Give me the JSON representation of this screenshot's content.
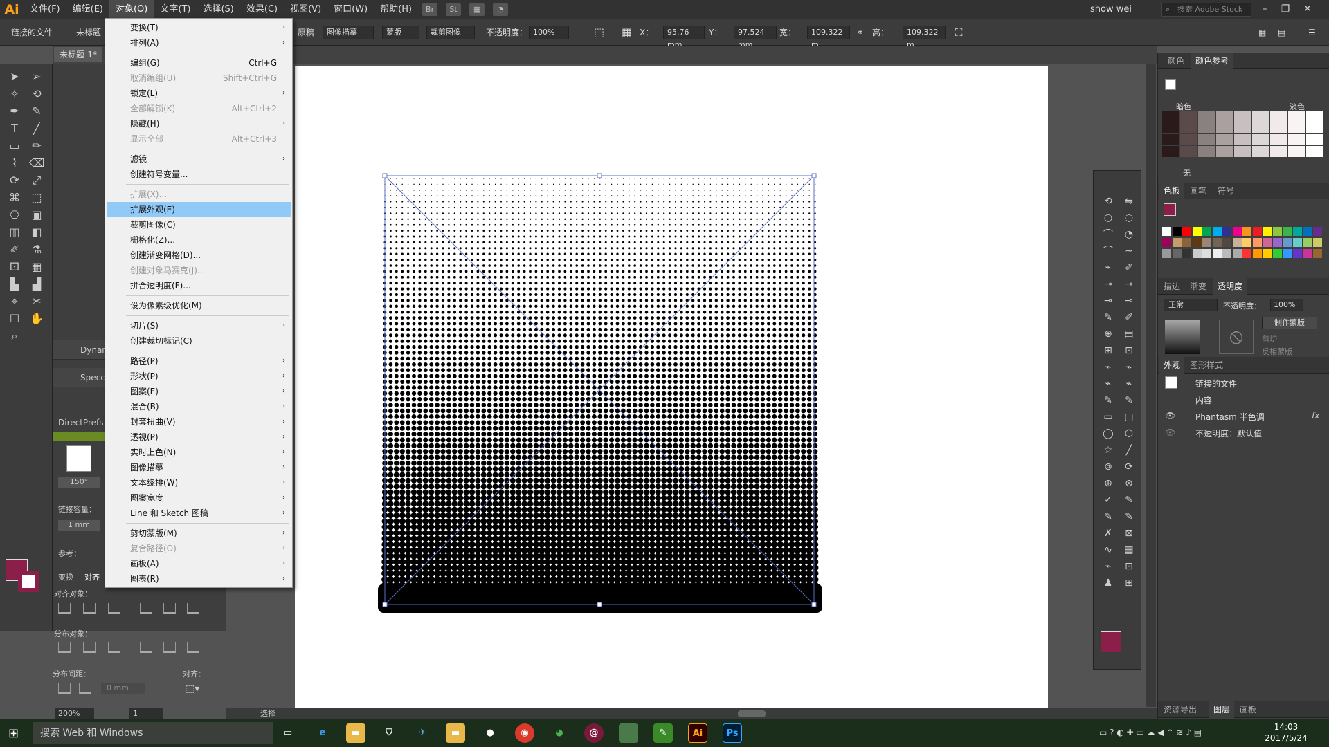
{
  "app": {
    "logo": "Ai",
    "menu": [
      "文件(F)",
      "编辑(E)",
      "对象(O)",
      "文字(T)",
      "选择(S)",
      "效果(C)",
      "视图(V)",
      "窗口(W)",
      "帮助(H)"
    ],
    "bridge": "Br",
    "stock": "St",
    "user": "show wei",
    "stock_search": "搜索 Adobe Stock"
  },
  "control": {
    "linked_file": "链接的文件",
    "unnamed": "未标题",
    "original": "原稿",
    "image_trace": "图像描摹",
    "mask": "蒙版",
    "crop_image": "裁剪图像",
    "opacity_label": "不透明度：",
    "opacity": "100%",
    "x_label": "X：",
    "x": "95.76 mm",
    "y_label": "Y：",
    "y": "97.524 mm",
    "w_label": "宽：",
    "w": "109.322 m",
    "h_label": "高：",
    "h": "109.322 m"
  },
  "doc": {
    "tab": "未标题-1*"
  },
  "left": {
    "dynamic": "Dynam",
    "spectr": "Specct",
    "directprefs": "DirectPrefs",
    "angle": "150°",
    "dashes_label": "链接容量：",
    "dashes": "1 mm",
    "ref_label": "参考：",
    "transform_tab": "变换",
    "align_tab": "对齐",
    "align_objects": "对齐对象：",
    "distribute_objects": "分布对象：",
    "distribute_spacing": "分布间距：",
    "align_to": "对齐：",
    "dist_value": "0 mm"
  },
  "dropdown": [
    {
      "label": "变换(T)",
      "arrow": "›",
      "dis": false
    },
    {
      "label": "排列(A)",
      "arrow": "›",
      "dis": false
    },
    {
      "sep": true
    },
    {
      "label": "编组(G)",
      "sc": "Ctrl+G",
      "dis": false
    },
    {
      "label": "取消编组(U)",
      "sc": "Shift+Ctrl+G",
      "dis": true
    },
    {
      "label": "锁定(L)",
      "arrow": "›",
      "dis": false
    },
    {
      "label": "全部解锁(K)",
      "sc": "Alt+Ctrl+2",
      "dis": true
    },
    {
      "label": "隐藏(H)",
      "arrow": "›",
      "dis": false
    },
    {
      "label": "显示全部",
      "sc": "Alt+Ctrl+3",
      "dis": true
    },
    {
      "sep": true
    },
    {
      "label": "滤镜",
      "arrow": "›",
      "dis": false
    },
    {
      "label": "创建符号变量...",
      "dis": false
    },
    {
      "sep": true
    },
    {
      "label": "扩展(X)...",
      "dis": true
    },
    {
      "label": "扩展外观(E)",
      "dis": false,
      "hl": true
    },
    {
      "label": "裁剪图像(C)",
      "dis": false
    },
    {
      "label": "栅格化(Z)...",
      "dis": false
    },
    {
      "label": "创建渐变网格(D)...",
      "dis": false
    },
    {
      "label": "创建对象马赛克(J)...",
      "dis": true
    },
    {
      "label": "拼合透明度(F)...",
      "dis": false
    },
    {
      "sep": true
    },
    {
      "label": "设为像素级优化(M)",
      "dis": false
    },
    {
      "sep": true
    },
    {
      "label": "切片(S)",
      "arrow": "›",
      "dis": false
    },
    {
      "label": "创建裁切标记(C)",
      "dis": false
    },
    {
      "sep": true
    },
    {
      "label": "路径(P)",
      "arrow": "›",
      "dis": false
    },
    {
      "label": "形状(P)",
      "arrow": "›",
      "dis": false
    },
    {
      "label": "图案(E)",
      "arrow": "›",
      "dis": false
    },
    {
      "label": "混合(B)",
      "arrow": "›",
      "dis": false
    },
    {
      "label": "封套扭曲(V)",
      "arrow": "›",
      "dis": false
    },
    {
      "label": "透视(P)",
      "arrow": "›",
      "dis": false
    },
    {
      "label": "实时上色(N)",
      "arrow": "›",
      "dis": false
    },
    {
      "label": "图像描摹",
      "arrow": "›",
      "dis": false
    },
    {
      "label": "文本绕排(W)",
      "arrow": "›",
      "dis": false
    },
    {
      "label": "图案宽度",
      "arrow": "›",
      "dis": false
    },
    {
      "label": "Line 和 Sketch 图稿",
      "arrow": "›",
      "dis": false
    },
    {
      "sep": true
    },
    {
      "label": "剪切蒙版(M)",
      "arrow": "›",
      "dis": false
    },
    {
      "label": "复合路径(O)",
      "arrow": "›",
      "dis": true
    },
    {
      "label": "画板(A)",
      "arrow": "›",
      "dis": false
    },
    {
      "label": "图表(R)",
      "arrow": "›",
      "dis": false
    }
  ],
  "right": {
    "color_tab": "颜色",
    "color_guide_tab": "颜色参考",
    "dark": "暗色",
    "light": "淡色",
    "none": "无",
    "swatches_tab": "色板",
    "brushes_tab": "画笔",
    "symbols_tab": "符号",
    "stroke_tab": "描边",
    "gradient_tab": "渐变",
    "transparency_tab": "透明度",
    "blend_mode": "正常",
    "opacity_label": "不透明度：",
    "opacity": "100%",
    "make_mask": "制作蒙版",
    "clip": "剪切",
    "invert_mask": "反相蒙版",
    "appearance_tab": "外观",
    "graphic_styles_tab": "图形样式",
    "linked_file": "链接的文件",
    "contents": "内容",
    "effect": "Phantasm 半色调",
    "opacity_default": "不透明度：默认值",
    "asset_export_tab": "资源导出",
    "layers_tab": "图层",
    "artboards_tab": "画板"
  },
  "status": {
    "zoom": "200%",
    "page": "1",
    "mode": "选择"
  },
  "taskbar": {
    "search": "搜索 Web 和 Windows",
    "time": "14:03",
    "date": "2017/5/24"
  },
  "colors": {
    "accent": "#f9a11b",
    "highlight": "#91c9f7",
    "fill": "#8b1f4a"
  }
}
